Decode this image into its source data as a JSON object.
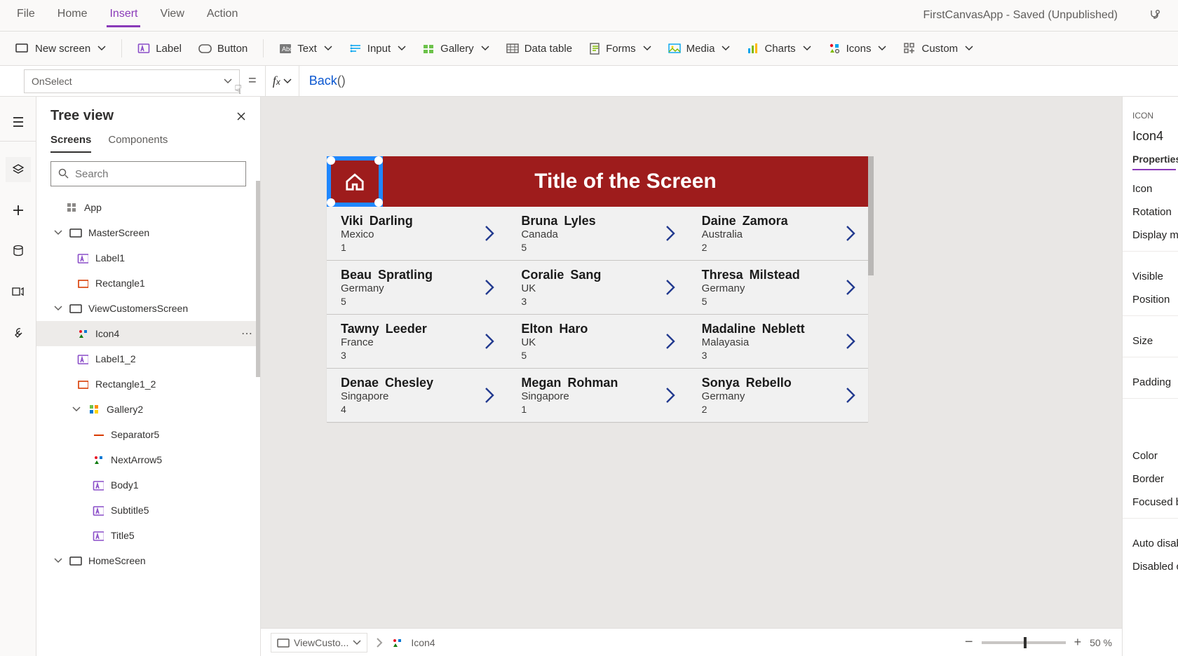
{
  "app_title": "FirstCanvasApp - Saved (Unpublished)",
  "menubar": {
    "file": "File",
    "home": "Home",
    "insert": "Insert",
    "view": "View",
    "action": "Action"
  },
  "ribbon": {
    "new_screen": "New screen",
    "label": "Label",
    "button": "Button",
    "text": "Text",
    "input": "Input",
    "gallery": "Gallery",
    "datatable": "Data table",
    "forms": "Forms",
    "media": "Media",
    "charts": "Charts",
    "icons": "Icons",
    "custom": "Custom"
  },
  "formula": {
    "property": "OnSelect",
    "expr_fn": "Back",
    "expr_args": "()"
  },
  "tree": {
    "title": "Tree view",
    "tabs": {
      "screens": "Screens",
      "components": "Components"
    },
    "search_placeholder": "Search",
    "items": {
      "app": "App",
      "master": "MasterScreen",
      "label1": "Label1",
      "rectangle1": "Rectangle1",
      "view": "ViewCustomersScreen",
      "icon4": "Icon4",
      "label1_2": "Label1_2",
      "rectangle1_2": "Rectangle1_2",
      "gallery2": "Gallery2",
      "separator5": "Separator5",
      "nextarrow5": "NextArrow5",
      "body1": "Body1",
      "subtitle5": "Subtitle5",
      "title5": "Title5",
      "home": "HomeScreen"
    }
  },
  "screen": {
    "title": "Title of the Screen",
    "cards": [
      {
        "name": "Viki  Darling",
        "sub": "Mexico",
        "num": "1"
      },
      {
        "name": "Bruna  Lyles",
        "sub": "Canada",
        "num": "5"
      },
      {
        "name": "Daine  Zamora",
        "sub": "Australia",
        "num": "2"
      },
      {
        "name": "Beau  Spratling",
        "sub": "Germany",
        "num": "5"
      },
      {
        "name": "Coralie  Sang",
        "sub": "UK",
        "num": "3"
      },
      {
        "name": "Thresa  Milstead",
        "sub": "Germany",
        "num": "5"
      },
      {
        "name": "Tawny  Leeder",
        "sub": "France",
        "num": "3"
      },
      {
        "name": "Elton  Haro",
        "sub": "UK",
        "num": "5"
      },
      {
        "name": "Madaline  Neblett",
        "sub": "Malayasia",
        "num": "3"
      },
      {
        "name": "Denae  Chesley",
        "sub": "Singapore",
        "num": "4"
      },
      {
        "name": "Megan  Rohman",
        "sub": "Singapore",
        "num": "1"
      },
      {
        "name": "Sonya  Rebello",
        "sub": "Germany",
        "num": "2"
      }
    ]
  },
  "status": {
    "crumb_screen": "ViewCusto...",
    "crumb_el": "Icon4",
    "zoom": "50 %"
  },
  "props": {
    "kind": "ICON",
    "name": "Icon4",
    "tab": "Properties",
    "rows": [
      "Icon",
      "Rotation",
      "Display mod"
    ],
    "rows2": [
      "Visible",
      "Position"
    ],
    "rows3": [
      "Size"
    ],
    "rows4": [
      "Padding"
    ],
    "rows5": [
      "Color",
      "Border",
      "Focused bor"
    ],
    "rows6": [
      "Auto disable",
      "Disabled col"
    ]
  }
}
